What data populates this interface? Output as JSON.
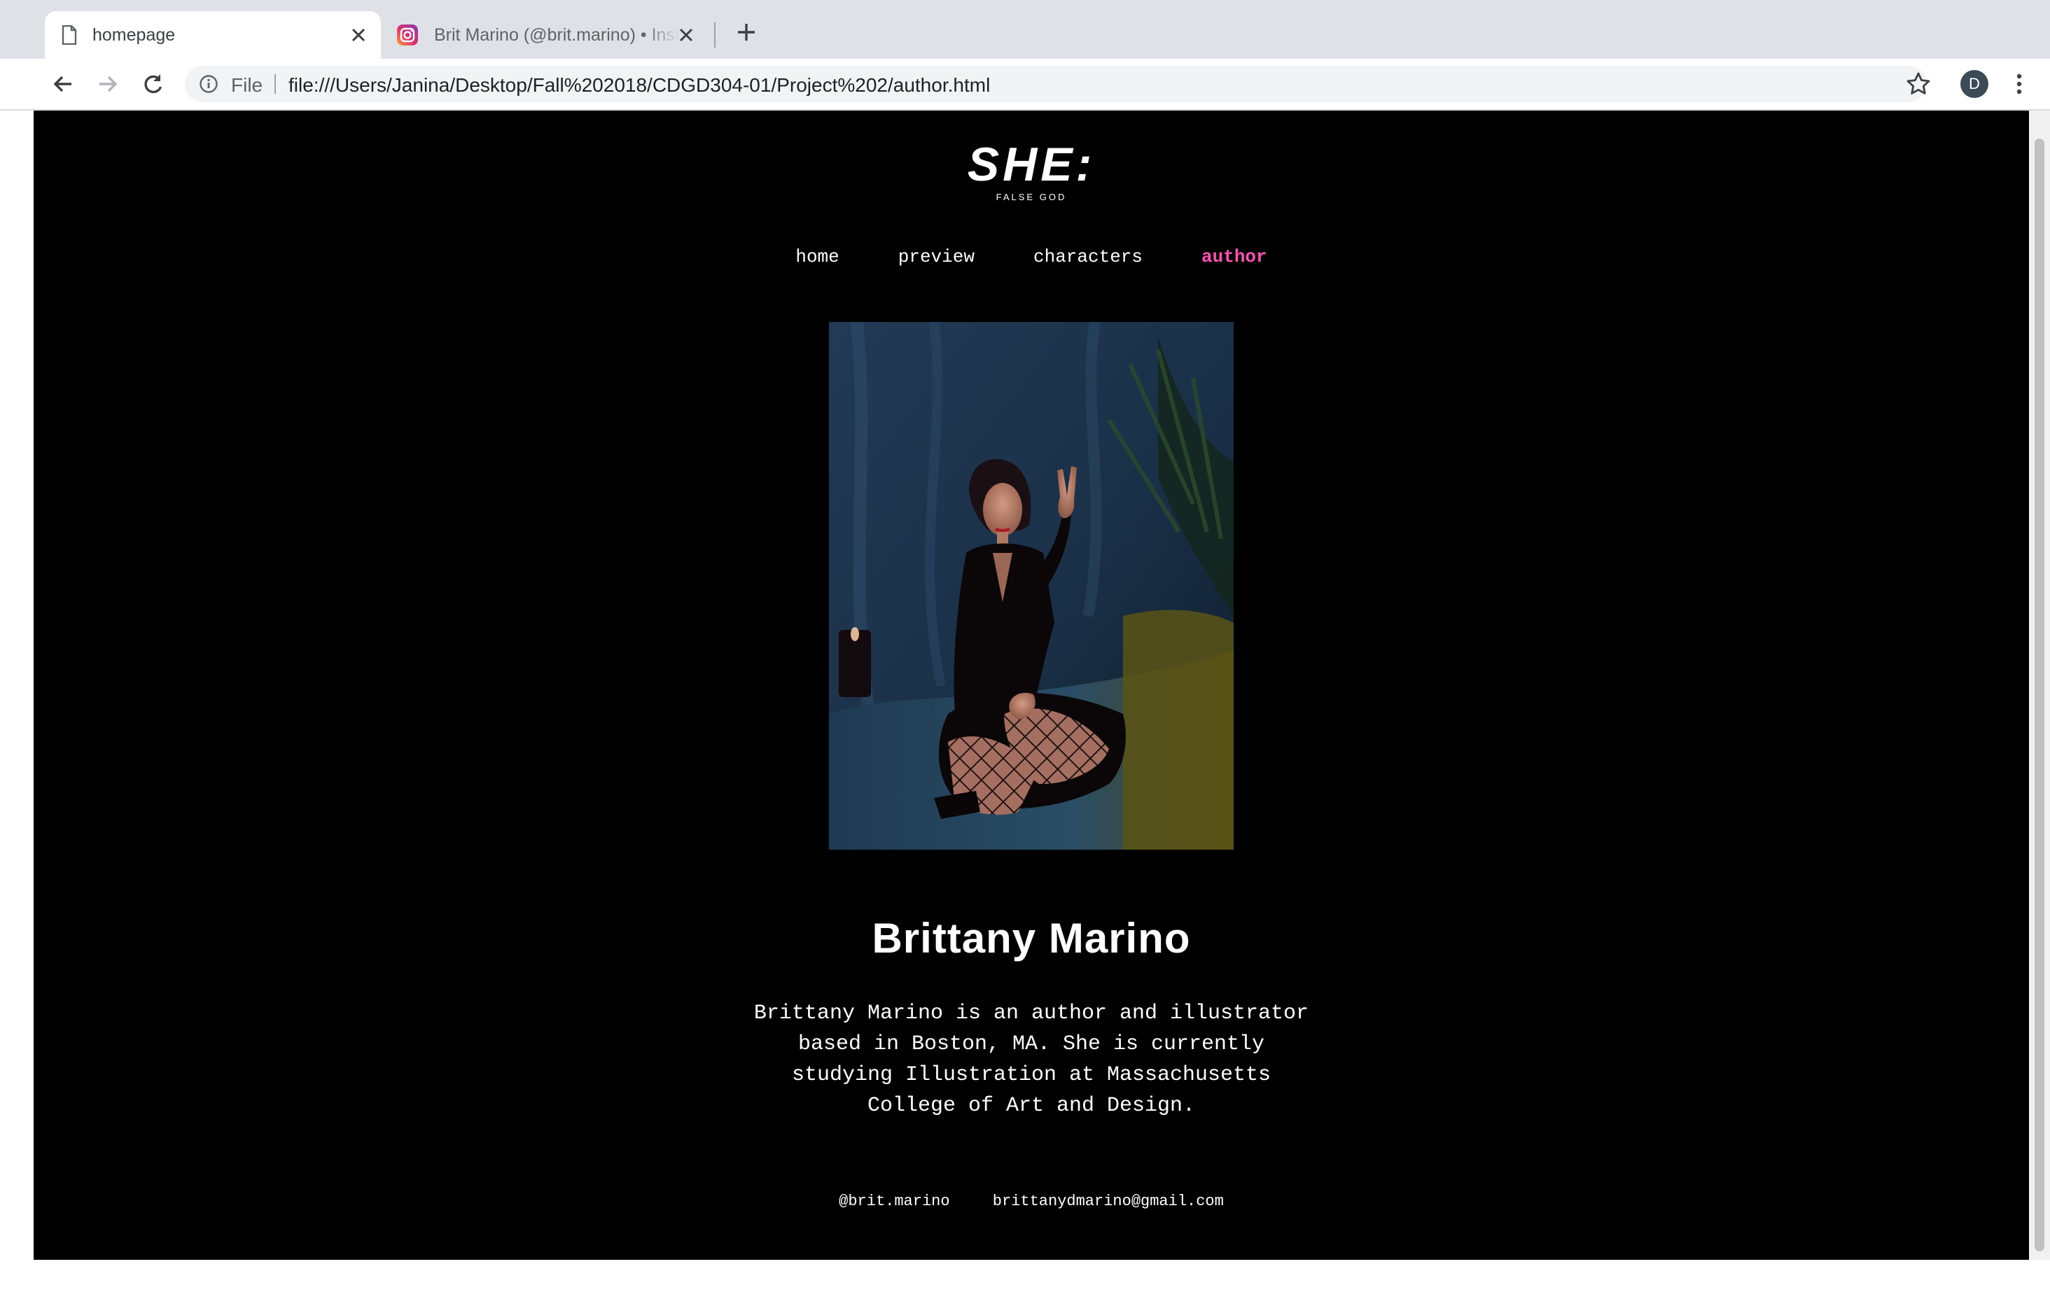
{
  "browser": {
    "tabs": [
      {
        "title": "homepage",
        "icon": "document-icon",
        "active": true
      },
      {
        "title": "Brit Marino (@brit.marino) • Instagram",
        "icon": "instagram-icon",
        "active": false
      }
    ],
    "address": {
      "scheme_label": "File",
      "url": "file:///Users/Janina/Desktop/Fall%202018/CDGD304-01/Project%202/author.html"
    },
    "profile_initial": "D"
  },
  "page": {
    "logo": "SHE:",
    "logo_sub": "FALSE GOD",
    "nav": [
      {
        "label": "home",
        "current": false
      },
      {
        "label": "preview",
        "current": false
      },
      {
        "label": "characters",
        "current": false
      },
      {
        "label": "author",
        "current": true
      }
    ],
    "author_name": "Brittany Marino",
    "bio_lines": [
      "Brittany Marino is an author and illustrator",
      "based in Boston, MA. She is currently",
      "studying Illustration at Massachusetts",
      "College of Art and Design."
    ],
    "instagram_handle": "@brit.marino",
    "email": "brittanydmarino@gmail.com"
  },
  "colors": {
    "page_background": "#000000",
    "nav_active": "#ff4fb5",
    "text": "#ffffff"
  }
}
